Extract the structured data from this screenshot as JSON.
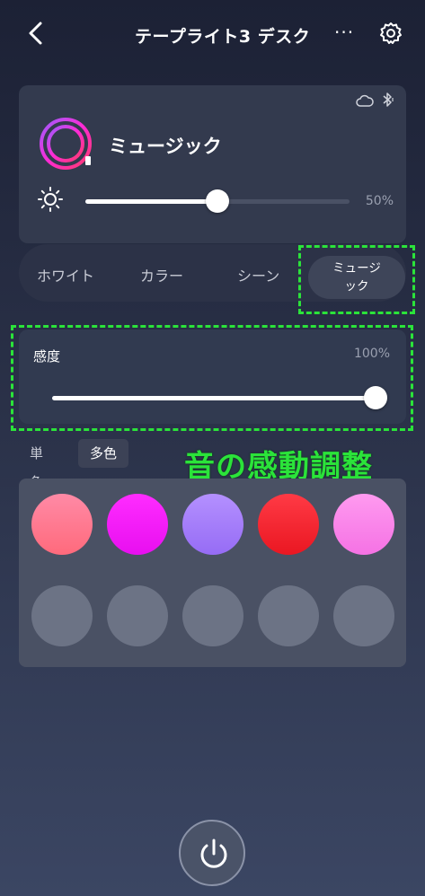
{
  "header": {
    "title": "テープライト3 デスク",
    "more_label": "···",
    "icons": [
      "back-chevron-icon",
      "more-icon",
      "gear-icon"
    ]
  },
  "device_card": {
    "mode_title": "ミュージック",
    "brightness_percent": 50,
    "brightness_label": "50%",
    "icons": [
      "cloud-icon",
      "bluetooth-icon",
      "tape-light-ring-icon",
      "sun-icon"
    ]
  },
  "mode_tabs": {
    "items": [
      {
        "label": "ホワイト"
      },
      {
        "label": "カラー"
      },
      {
        "label": "シーン"
      },
      {
        "label": "ミュージ\nック"
      }
    ],
    "active_index": 3
  },
  "sensitivity": {
    "label": "感度",
    "value_label": "100%",
    "value_percent": 100
  },
  "color_tabs": {
    "single": "単色",
    "multi": "多色",
    "active": "multi"
  },
  "annotation": {
    "text": "音の感動調整"
  },
  "palette": {
    "colors": [
      "#ff7e92",
      "#ff1fff",
      "#a57dff",
      "#ff2a34",
      "#ff86ec",
      null,
      null,
      null,
      null,
      null
    ]
  },
  "colors": {
    "highlight": "#2be33a",
    "background": "#262c42",
    "accent": "#ffffff"
  }
}
